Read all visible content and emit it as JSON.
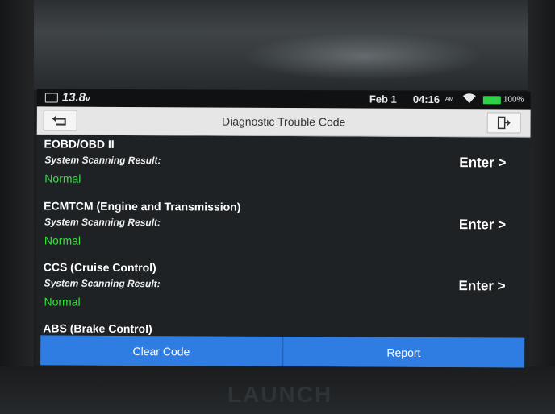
{
  "device": {
    "brand": "LAUNCH"
  },
  "status_bar": {
    "voltage": "13.8",
    "voltage_unit": "v",
    "date": "Feb 1",
    "time": "04:16",
    "ampm": "AM",
    "battery_pct": "100%",
    "battery_color": "#2fd14a"
  },
  "header": {
    "title": "Diagnostic Trouble Code",
    "back_icon": "back-arrow-icon",
    "exit_icon": "exit-icon"
  },
  "systems": [
    {
      "name": "EOBD/OBD II",
      "label": "System Scanning Result:",
      "status": "Normal",
      "action": "Enter >"
    },
    {
      "name": "ECMTCM (Engine and Transmission)",
      "label": "System Scanning Result:",
      "status": "Normal",
      "action": "Enter >"
    },
    {
      "name": "CCS (Cruise Control)",
      "label": "System Scanning Result:",
      "status": "Normal",
      "action": "Enter >"
    },
    {
      "name": "ABS (Brake Control)"
    }
  ],
  "footer": {
    "clear_code": "Clear Code",
    "report": "Report",
    "accent_color": "#2f7de3"
  },
  "colors": {
    "normal_status": "#34e33a"
  }
}
